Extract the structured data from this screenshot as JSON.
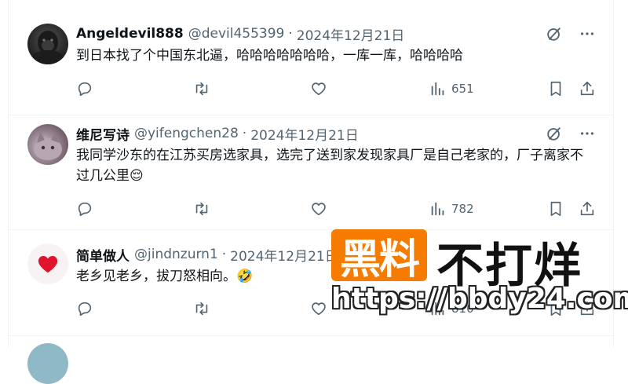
{
  "tweets": [
    {
      "username": "Angeldevil888",
      "handle": "@devil455399",
      "separator": "·",
      "date": "2024年12月21日",
      "text": "到日本找了个中国东北逼，哈哈哈哈哈哈哈，一库一库，哈哈哈哈",
      "views": "651",
      "avatar": "gorilla-avatar"
    },
    {
      "username": "维尼写诗",
      "handle": "@yifengchen28",
      "separator": "·",
      "date": "2024年12月21日",
      "text": "我同学沙东的在江苏买房选家具，选完了送到家发现家具厂是自己老家的，厂子离家不过几公里😌",
      "views": "782",
      "avatar": "cat-avatar"
    },
    {
      "username": "简单做人",
      "handle": "@jindnzurn1",
      "separator": "·",
      "date": "2024年12月21日",
      "text": "老乡见老乡，拔刀怒相向。🤣",
      "views": "810",
      "avatar": "heart-avatar"
    }
  ],
  "watermark": {
    "badge": "黑料",
    "title": "不打烊",
    "url": "https://bbdy24.com"
  },
  "colors": {
    "text": "#0f1419",
    "muted": "#536471",
    "divider": "#eff3f4",
    "watermark_orange": "#f57c00"
  }
}
